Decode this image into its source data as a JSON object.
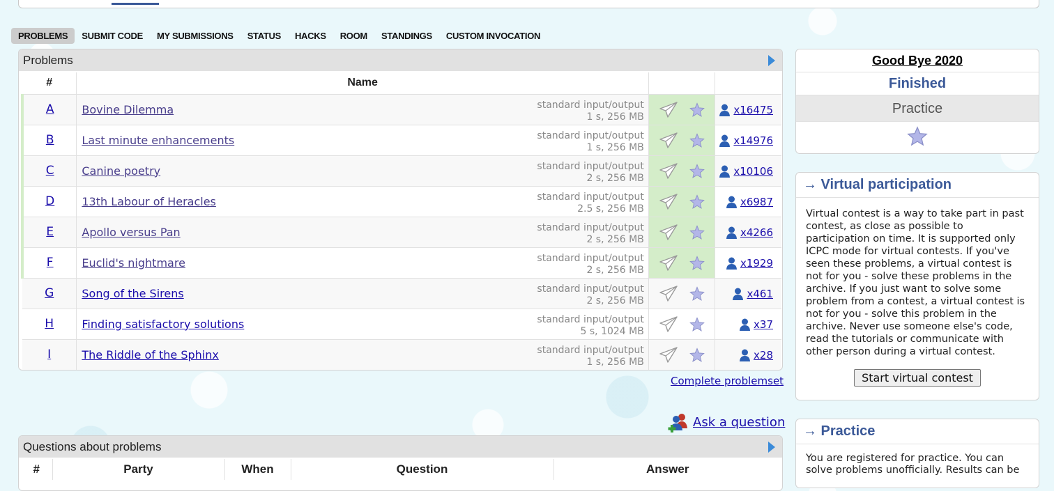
{
  "menu": [
    {
      "label": "Problems",
      "active": true
    },
    {
      "label": "Submit Code",
      "active": false
    },
    {
      "label": "My Submissions",
      "active": false
    },
    {
      "label": "Status",
      "active": false
    },
    {
      "label": "Hacks",
      "active": false
    },
    {
      "label": "Room",
      "active": false
    },
    {
      "label": "Standings",
      "active": false
    },
    {
      "label": "Custom Invocation",
      "active": false
    }
  ],
  "problems": {
    "caption": "Problems",
    "headers": {
      "index": "#",
      "name": "Name"
    },
    "rows": [
      {
        "index": "A",
        "name": "Bovine Dilemma",
        "io": "standard input/output",
        "limits": "1 s, 256 MB",
        "solvers": "x16475",
        "solved": true
      },
      {
        "index": "B",
        "name": "Last minute enhancements",
        "io": "standard input/output",
        "limits": "1 s, 256 MB",
        "solvers": "x14976",
        "solved": true
      },
      {
        "index": "C",
        "name": "Canine poetry",
        "io": "standard input/output",
        "limits": "2 s, 256 MB",
        "solvers": "x10106",
        "solved": true
      },
      {
        "index": "D",
        "name": "13th Labour of Heracles",
        "io": "standard input/output",
        "limits": "2.5 s, 256 MB",
        "solvers": "x6987",
        "solved": true
      },
      {
        "index": "E",
        "name": "Apollo versus Pan",
        "io": "standard input/output",
        "limits": "2 s, 256 MB",
        "solvers": "x4266",
        "solved": true
      },
      {
        "index": "F",
        "name": "Euclid's nightmare",
        "io": "standard input/output",
        "limits": "2 s, 256 MB",
        "solvers": "x1929",
        "solved": true
      },
      {
        "index": "G",
        "name": "Song of the Sirens",
        "io": "standard input/output",
        "limits": "2 s, 256 MB",
        "solvers": "x461",
        "solved": false
      },
      {
        "index": "H",
        "name": "Finding satisfactory solutions",
        "io": "standard input/output",
        "limits": "5 s, 1024 MB",
        "solvers": "x37",
        "solved": false
      },
      {
        "index": "I",
        "name": "The Riddle of the Sphinx",
        "io": "standard input/output",
        "limits": "1 s, 256 MB",
        "solvers": "x28",
        "solved": false
      }
    ],
    "complete_link": "Complete problemset"
  },
  "ask": {
    "label": "Ask a question"
  },
  "questions": {
    "caption": "Questions about problems",
    "headers": [
      "#",
      "Party",
      "When",
      "Question",
      "Answer"
    ]
  },
  "contest": {
    "title": "Good Bye 2020",
    "status": "Finished",
    "mode": "Practice"
  },
  "virtual": {
    "caption": "→ Virtual participation",
    "text": "Virtual contest is a way to take part in past contest, as close as possible to participation on time. It is supported only ICPC mode for virtual contests. If you've seen these problems, a virtual contest is not for you - solve these problems in the archive. If you just want to solve some problem from a contest, a virtual contest is not for you - solve this problem in the archive. Never use someone else's code, read the tutorials or communicate with other person during a virtual contest.",
    "button": "Start virtual contest"
  },
  "practice": {
    "caption": "→ Practice",
    "text": "You are registered for practice. You can solve problems unofficially. Results can be"
  },
  "colors": {
    "accepted": "#d4edc9",
    "accent": "#3b5998",
    "link": "#1a0dab"
  },
  "icons": {
    "submit": "paper-plane-icon",
    "favorite": "star-icon",
    "solvers": "user-icon",
    "ask": "users-add-icon",
    "caption": "arrow-right-icon"
  }
}
